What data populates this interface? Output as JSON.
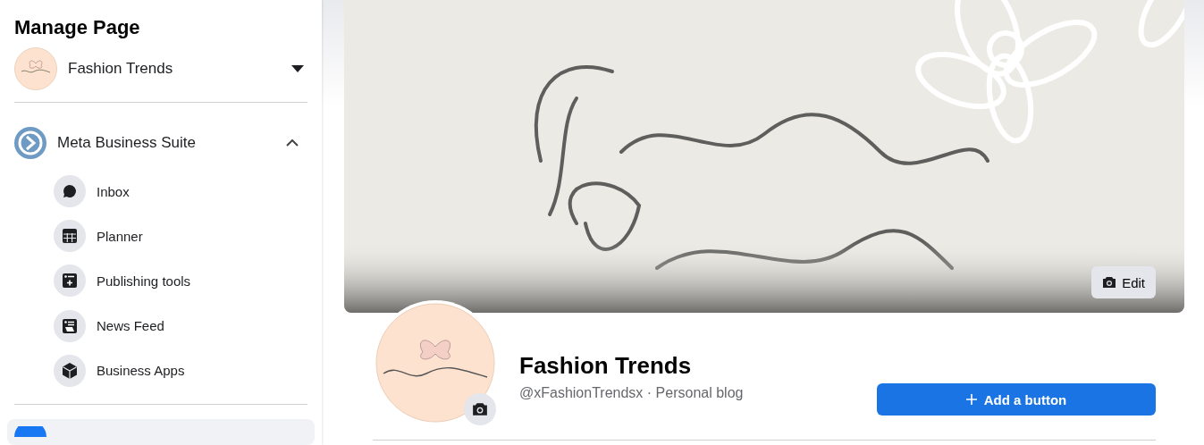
{
  "sidebar": {
    "title": "Manage Page",
    "page_switcher": {
      "name": "Fashion Trends"
    },
    "section": {
      "label": "Meta Business Suite",
      "expanded": true,
      "items": [
        {
          "label": "Inbox",
          "kind": "inbox"
        },
        {
          "label": "Planner",
          "kind": "planner"
        },
        {
          "label": "Publishing tools",
          "kind": "publishing"
        },
        {
          "label": "News Feed",
          "kind": "feed"
        },
        {
          "label": "Business Apps",
          "kind": "apps"
        }
      ]
    }
  },
  "cover": {
    "kind": "picture",
    "edit_button": "Edit"
  },
  "profile": {
    "name": "Fashion Trends",
    "subtitle": "@xFashionTrendsx · Personal blog",
    "action_button": "Add a button"
  }
}
